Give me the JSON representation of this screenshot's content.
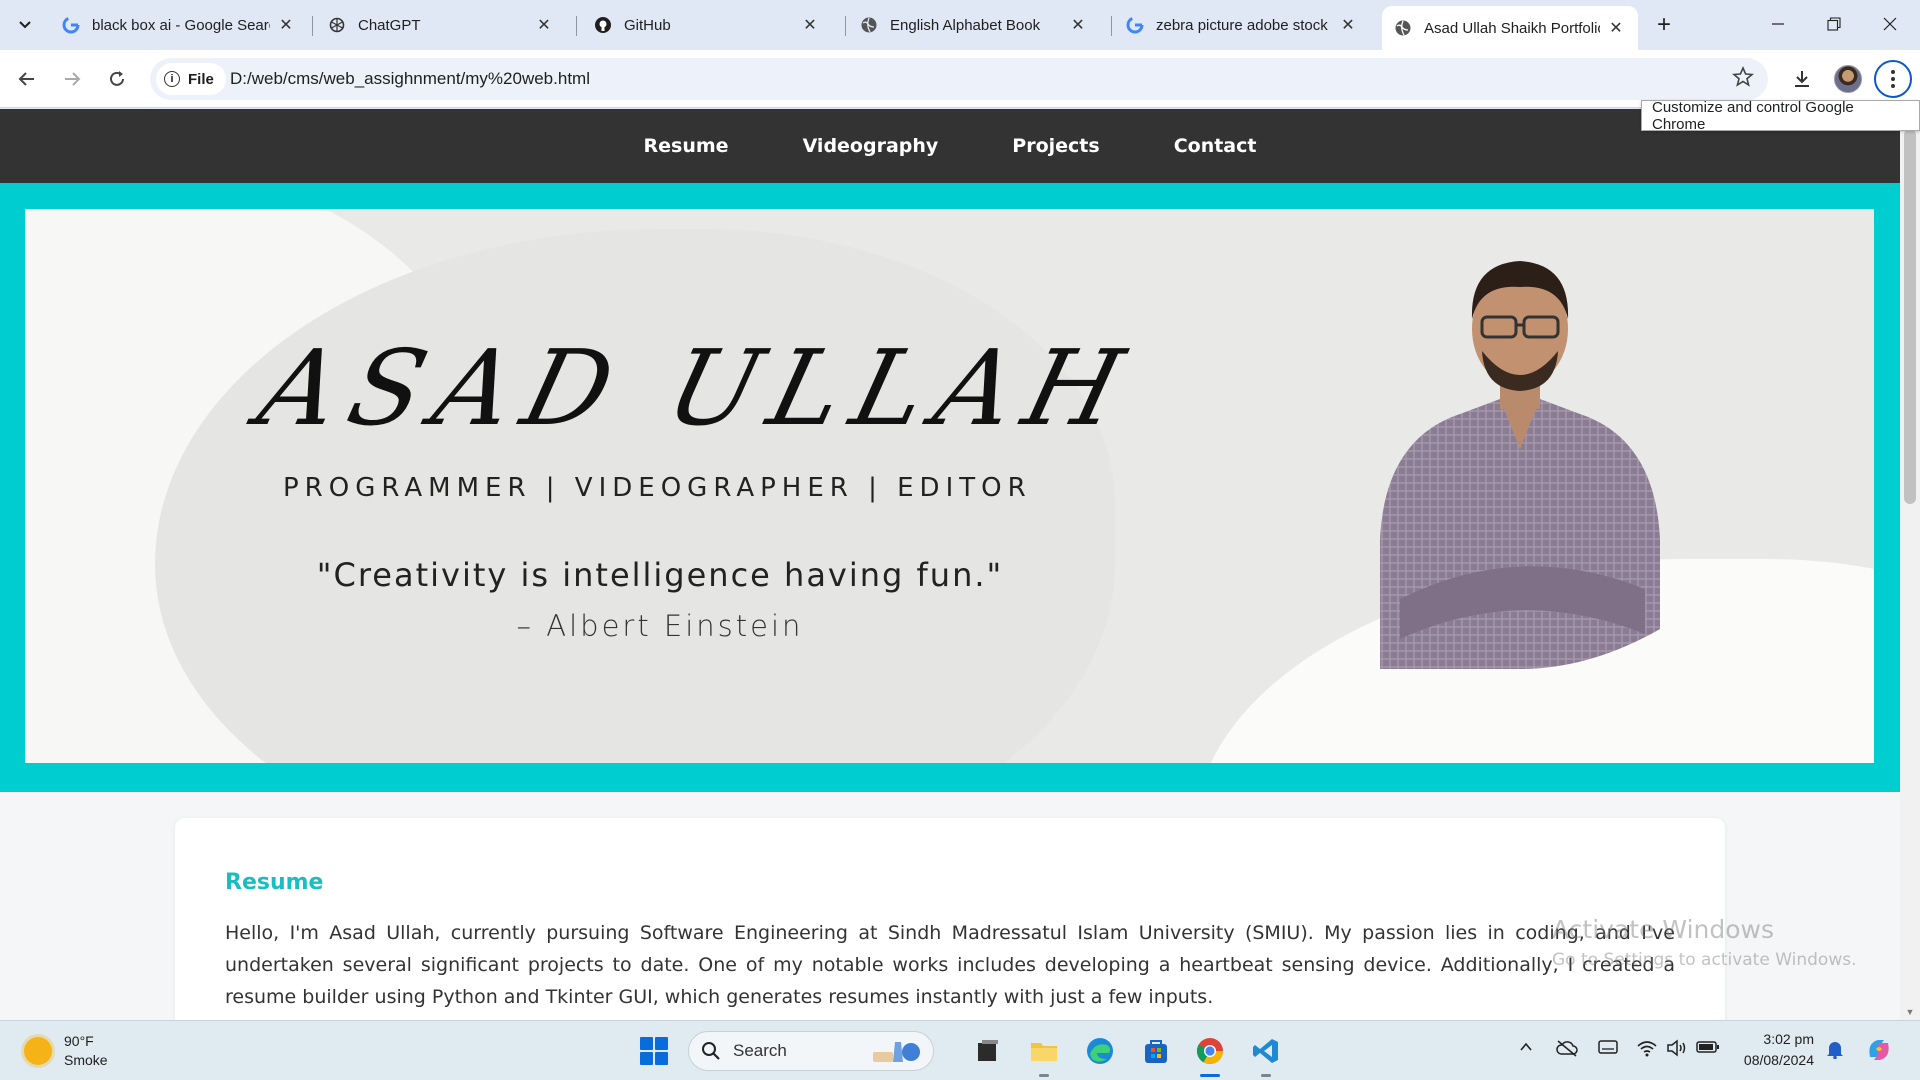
{
  "browser": {
    "tabs": [
      {
        "title": "black box ai - Google Search",
        "icon": "google-icon"
      },
      {
        "title": "ChatGPT",
        "icon": "chatgpt-icon"
      },
      {
        "title": "GitHub",
        "icon": "github-icon"
      },
      {
        "title": "English Alphabet Book",
        "icon": "globe-icon"
      },
      {
        "title": "zebra picture adobe stock",
        "icon": "google-icon"
      },
      {
        "title": "Asad Ullah Shaikh Portfolio",
        "icon": "globe-icon",
        "active": true
      }
    ],
    "address": {
      "chip_label": "File",
      "url": "D:/web/cms/web_assighnment/my%20web.html"
    },
    "menu_tooltip": "Customize and control Google Chrome"
  },
  "page": {
    "nav": [
      "Resume",
      "Videography",
      "Projects",
      "Contact"
    ],
    "hero": {
      "name": "ASAD ULLAH",
      "subtitle": "PROGRAMMER | VIDEOGRAPHER | EDITOR",
      "quote": "\"Creativity is intelligence having fun.\"",
      "author": "– Albert Einstein"
    },
    "resume": {
      "heading": "Resume",
      "text": "Hello, I'm Asad Ullah, currently pursuing Software Engineering at Sindh Madressatul Islam University (SMIU). My passion lies in coding, and I've undertaken several significant projects to date. One of my notable works includes developing a heartbeat sensing device. Additionally, I created a resume builder using Python and Tkinter GUI, which generates resumes instantly with just a few inputs."
    },
    "watermark": {
      "line1": "Activate Windows",
      "line2": "Go to Settings to activate Windows."
    }
  },
  "taskbar": {
    "weather": {
      "temp": "90°F",
      "desc": "Smoke"
    },
    "search_label": "Search",
    "clock": {
      "time": "3:02 pm",
      "date": "08/08/2024"
    }
  },
  "colors": {
    "accent": "#00cdd0",
    "nav_bg": "#333333",
    "heading": "#17bfc2"
  }
}
